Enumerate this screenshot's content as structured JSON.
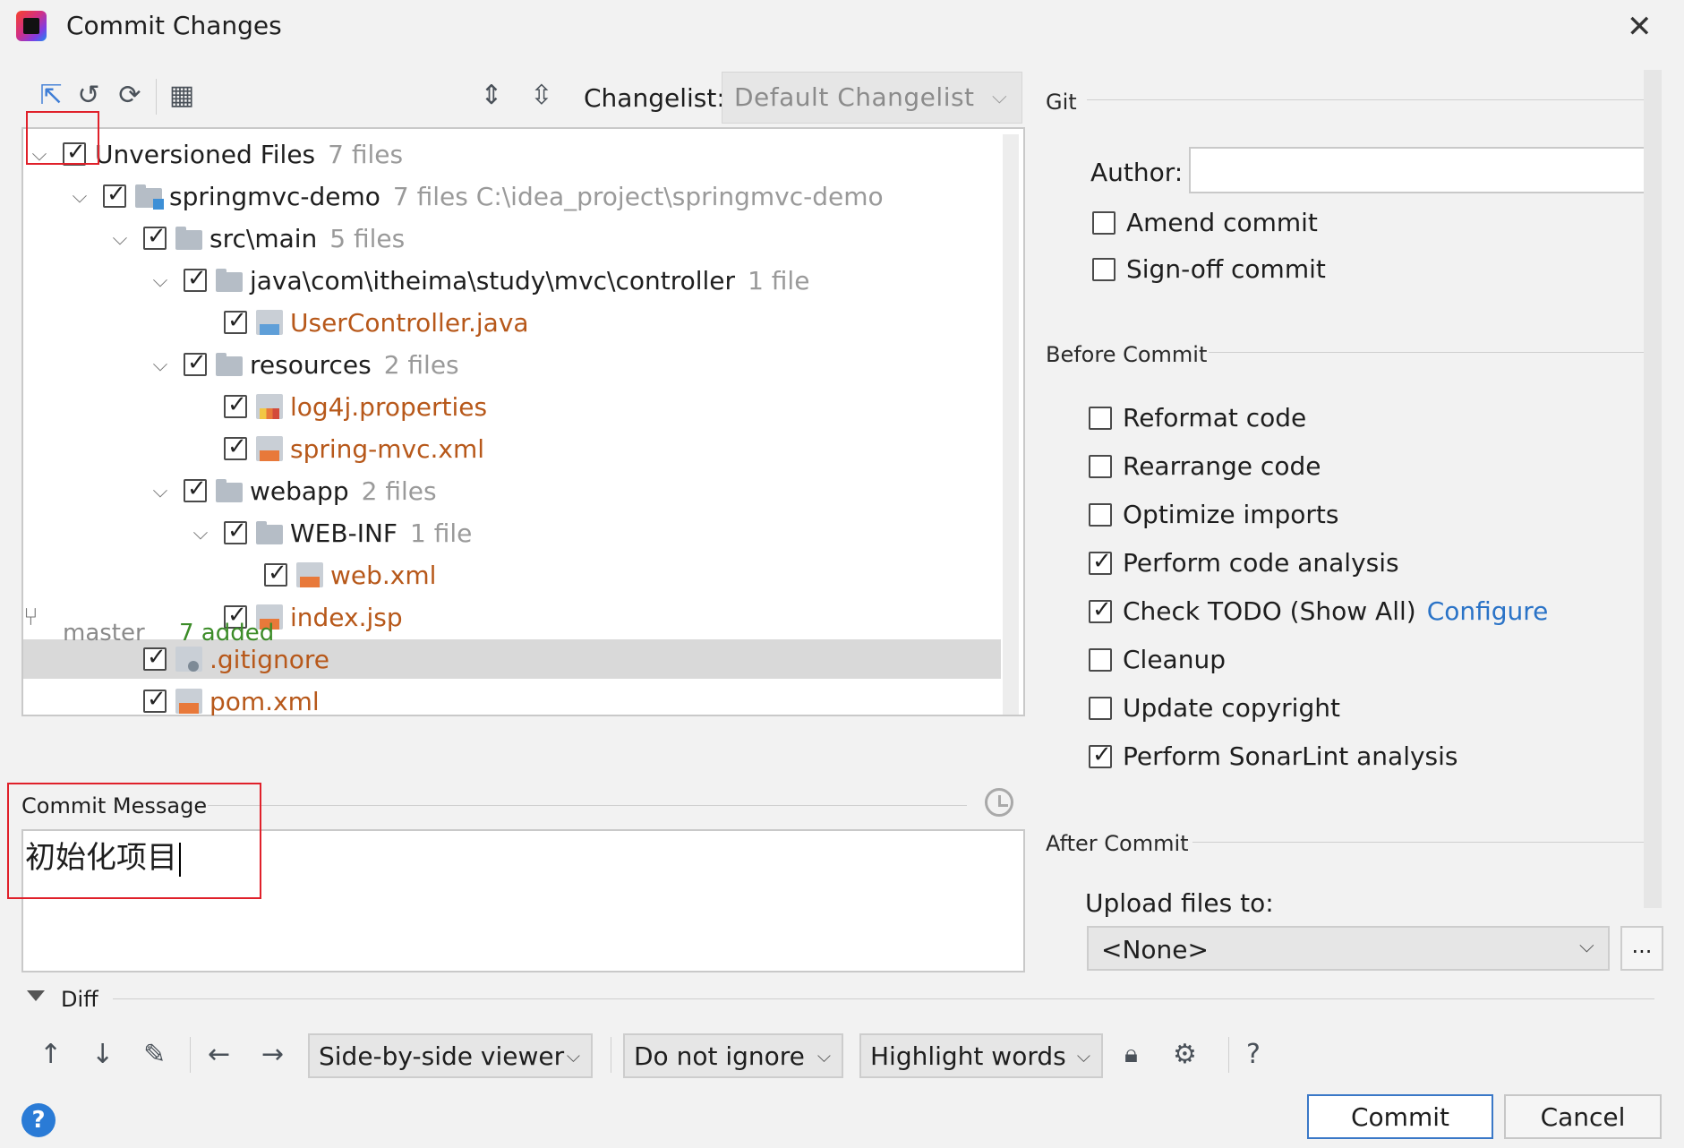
{
  "window": {
    "title": "Commit Changes",
    "close_icon": "close-icon"
  },
  "toolbar": {
    "changelist_label": "Changelist:",
    "changelist_value": "Default Changelist"
  },
  "tree": [
    {
      "label": "Unversioned Files",
      "meta": "7 files",
      "level": 0,
      "expanded": true,
      "checked": true,
      "icon": "none",
      "orange": false
    },
    {
      "label": "springmvc-demo",
      "meta": "7 files  C:\\idea_project\\springmvc-demo",
      "level": 1,
      "expanded": true,
      "checked": true,
      "icon": "module-folder",
      "orange": false
    },
    {
      "label": "src\\main",
      "meta": "5 files",
      "level": 2,
      "expanded": true,
      "checked": true,
      "icon": "folder",
      "orange": false
    },
    {
      "label": "java\\com\\itheima\\study\\mvc\\controller",
      "meta": "1 file",
      "level": 3,
      "expanded": true,
      "checked": true,
      "icon": "folder",
      "orange": false
    },
    {
      "label": "UserController.java",
      "meta": "",
      "level": 4,
      "expanded": null,
      "checked": true,
      "icon": "java-file",
      "orange": true
    },
    {
      "label": "resources",
      "meta": "2 files",
      "level": 3,
      "expanded": true,
      "checked": true,
      "icon": "folder",
      "orange": false
    },
    {
      "label": "log4j.properties",
      "meta": "",
      "level": 4,
      "expanded": null,
      "checked": true,
      "icon": "properties-file",
      "orange": true
    },
    {
      "label": "spring-mvc.xml",
      "meta": "",
      "level": 4,
      "expanded": null,
      "checked": true,
      "icon": "xml-file",
      "orange": true
    },
    {
      "label": "webapp",
      "meta": "2 files",
      "level": 3,
      "expanded": true,
      "checked": true,
      "icon": "folder",
      "orange": false
    },
    {
      "label": "WEB-INF",
      "meta": "1 file",
      "level": 4,
      "expanded": true,
      "checked": true,
      "icon": "folder",
      "orange": false
    },
    {
      "label": "web.xml",
      "meta": "",
      "level": 5,
      "expanded": null,
      "checked": true,
      "icon": "xml-file",
      "orange": true
    },
    {
      "label": "index.jsp",
      "meta": "",
      "level": 4,
      "expanded": null,
      "checked": true,
      "icon": "jsp-file",
      "orange": true
    },
    {
      "label": ".gitignore",
      "meta": "",
      "level": 2,
      "expanded": null,
      "checked": true,
      "icon": "gitignore-file",
      "orange": true,
      "selected": true
    },
    {
      "label": "pom.xml",
      "meta": "",
      "level": 2,
      "expanded": null,
      "checked": true,
      "icon": "xml-file",
      "orange": true
    }
  ],
  "status": {
    "branch": "master",
    "added": "7 added"
  },
  "commit_message": {
    "label": "Commit Message",
    "value": "初始化项目"
  },
  "git": {
    "section": "Git",
    "author_label": "Author:",
    "author_value": "",
    "amend": {
      "label": "Amend commit",
      "checked": false
    },
    "signoff": {
      "label": "Sign-off commit",
      "checked": false
    }
  },
  "before_commit": {
    "section": "Before Commit",
    "options": [
      {
        "label": "Reformat code",
        "checked": false
      },
      {
        "label": "Rearrange code",
        "checked": false
      },
      {
        "label": "Optimize imports",
        "checked": false
      },
      {
        "label": "Perform code analysis",
        "checked": true
      },
      {
        "label": "Check TODO (Show All)",
        "checked": true,
        "link": "Configure"
      },
      {
        "label": "Cleanup",
        "checked": false
      },
      {
        "label": "Update copyright",
        "checked": false
      },
      {
        "label": "Perform SonarLint analysis",
        "checked": true
      }
    ]
  },
  "after_commit": {
    "section": "After Commit",
    "upload_label": "Upload files to:",
    "upload_value": "<None>",
    "browse_label": "..."
  },
  "diff": {
    "label": "Diff",
    "viewer": "Side-by-side viewer",
    "ignore": "Do not ignore",
    "highlight": "Highlight words"
  },
  "buttons": {
    "commit": "Commit",
    "cancel": "Cancel",
    "help": "?"
  },
  "colors": {
    "accent": "#2a73c7",
    "added": "#3c8c28",
    "unversioned": "#b7581a",
    "highlight_box": "#e0202a"
  }
}
